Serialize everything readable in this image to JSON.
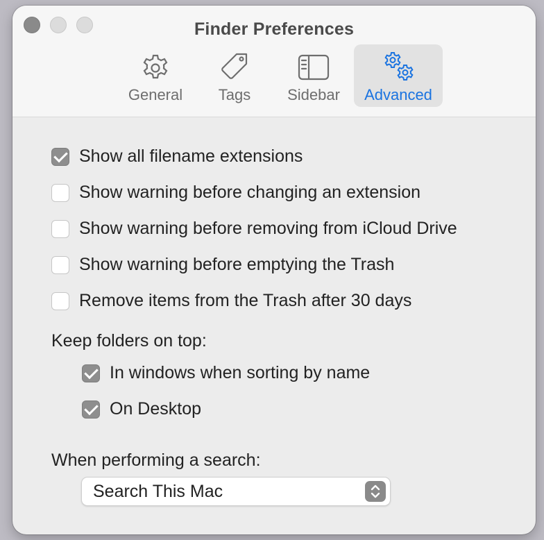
{
  "window": {
    "title": "Finder Preferences"
  },
  "tabs": [
    {
      "label": "General",
      "icon": "gear-icon"
    },
    {
      "label": "Tags",
      "icon": "tag-icon"
    },
    {
      "label": "Sidebar",
      "icon": "sidebar-icon"
    },
    {
      "label": "Advanced",
      "icon": "gears-icon",
      "active": true
    }
  ],
  "options": [
    {
      "label": "Show all filename extensions",
      "checked": true
    },
    {
      "label": "Show warning before changing an extension",
      "checked": false
    },
    {
      "label": "Show warning before removing from iCloud Drive",
      "checked": false
    },
    {
      "label": "Show warning before emptying the Trash",
      "checked": false
    },
    {
      "label": "Remove items from the Trash after 30 days",
      "checked": false
    }
  ],
  "folders_on_top": {
    "heading": "Keep folders on top:",
    "items": [
      {
        "label": "In windows when sorting by name",
        "checked": true
      },
      {
        "label": "On Desktop",
        "checked": true
      }
    ]
  },
  "search": {
    "heading": "When performing a search:",
    "selected": "Search This Mac"
  },
  "colors": {
    "accent": "#1a73e0",
    "checked_box": "#8e8e8e"
  }
}
